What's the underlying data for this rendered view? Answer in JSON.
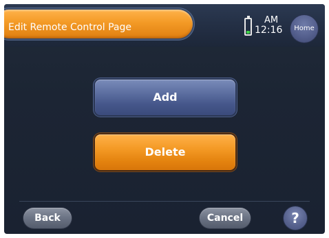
{
  "header": {
    "title": "Edit Remote Control Page",
    "clock_ampm": "AM",
    "clock_time": "12:16",
    "battery_level": 0.2,
    "home_label": "Home"
  },
  "main": {
    "add_label": "Add",
    "delete_label": "Delete"
  },
  "footer": {
    "back_label": "Back",
    "cancel_label": "Cancel",
    "help_label": "?"
  },
  "colors": {
    "accent_orange": "#f39a26",
    "button_blue": "#5b6d9f",
    "background": "#1c2534",
    "battery_green": "#3fd34a"
  },
  "icons": {
    "battery": "battery-icon",
    "help": "help-icon"
  }
}
